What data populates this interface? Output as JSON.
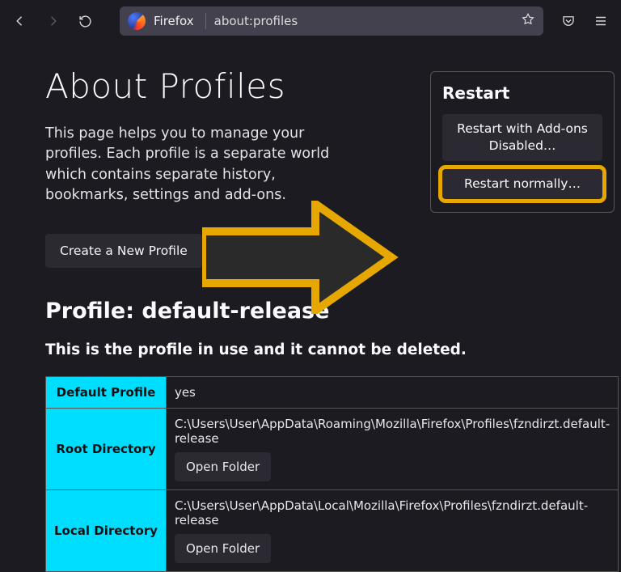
{
  "toolbar": {
    "identity_label": "Firefox",
    "url": "about:profiles"
  },
  "page": {
    "title": "About Profiles",
    "lead": "This page helps you to manage your profiles. Each profile is a separate world which contains separate history, bookmarks, settings and add-ons.",
    "create_label": "Create a New Profile"
  },
  "restart": {
    "heading": "Restart",
    "btn_addons": "Restart with Add-ons Disabled…",
    "btn_normal": "Restart normally…"
  },
  "profile": {
    "heading": "Profile: default-release",
    "in_use": "This is the profile in use and it cannot be deleted.",
    "rows": {
      "default_profile_label": "Default Profile",
      "default_profile_value": "yes",
      "root_dir_label": "Root Directory",
      "root_dir_value": "C:\\Users\\User\\AppData\\Roaming\\Mozilla\\Firefox\\Profiles\\fzndirzt.default-release",
      "local_dir_label": "Local Directory",
      "local_dir_value": "C:\\Users\\User\\AppData\\Local\\Mozilla\\Firefox\\Profiles\\fzndirzt.default-release",
      "open_folder_label": "Open Folder"
    }
  }
}
